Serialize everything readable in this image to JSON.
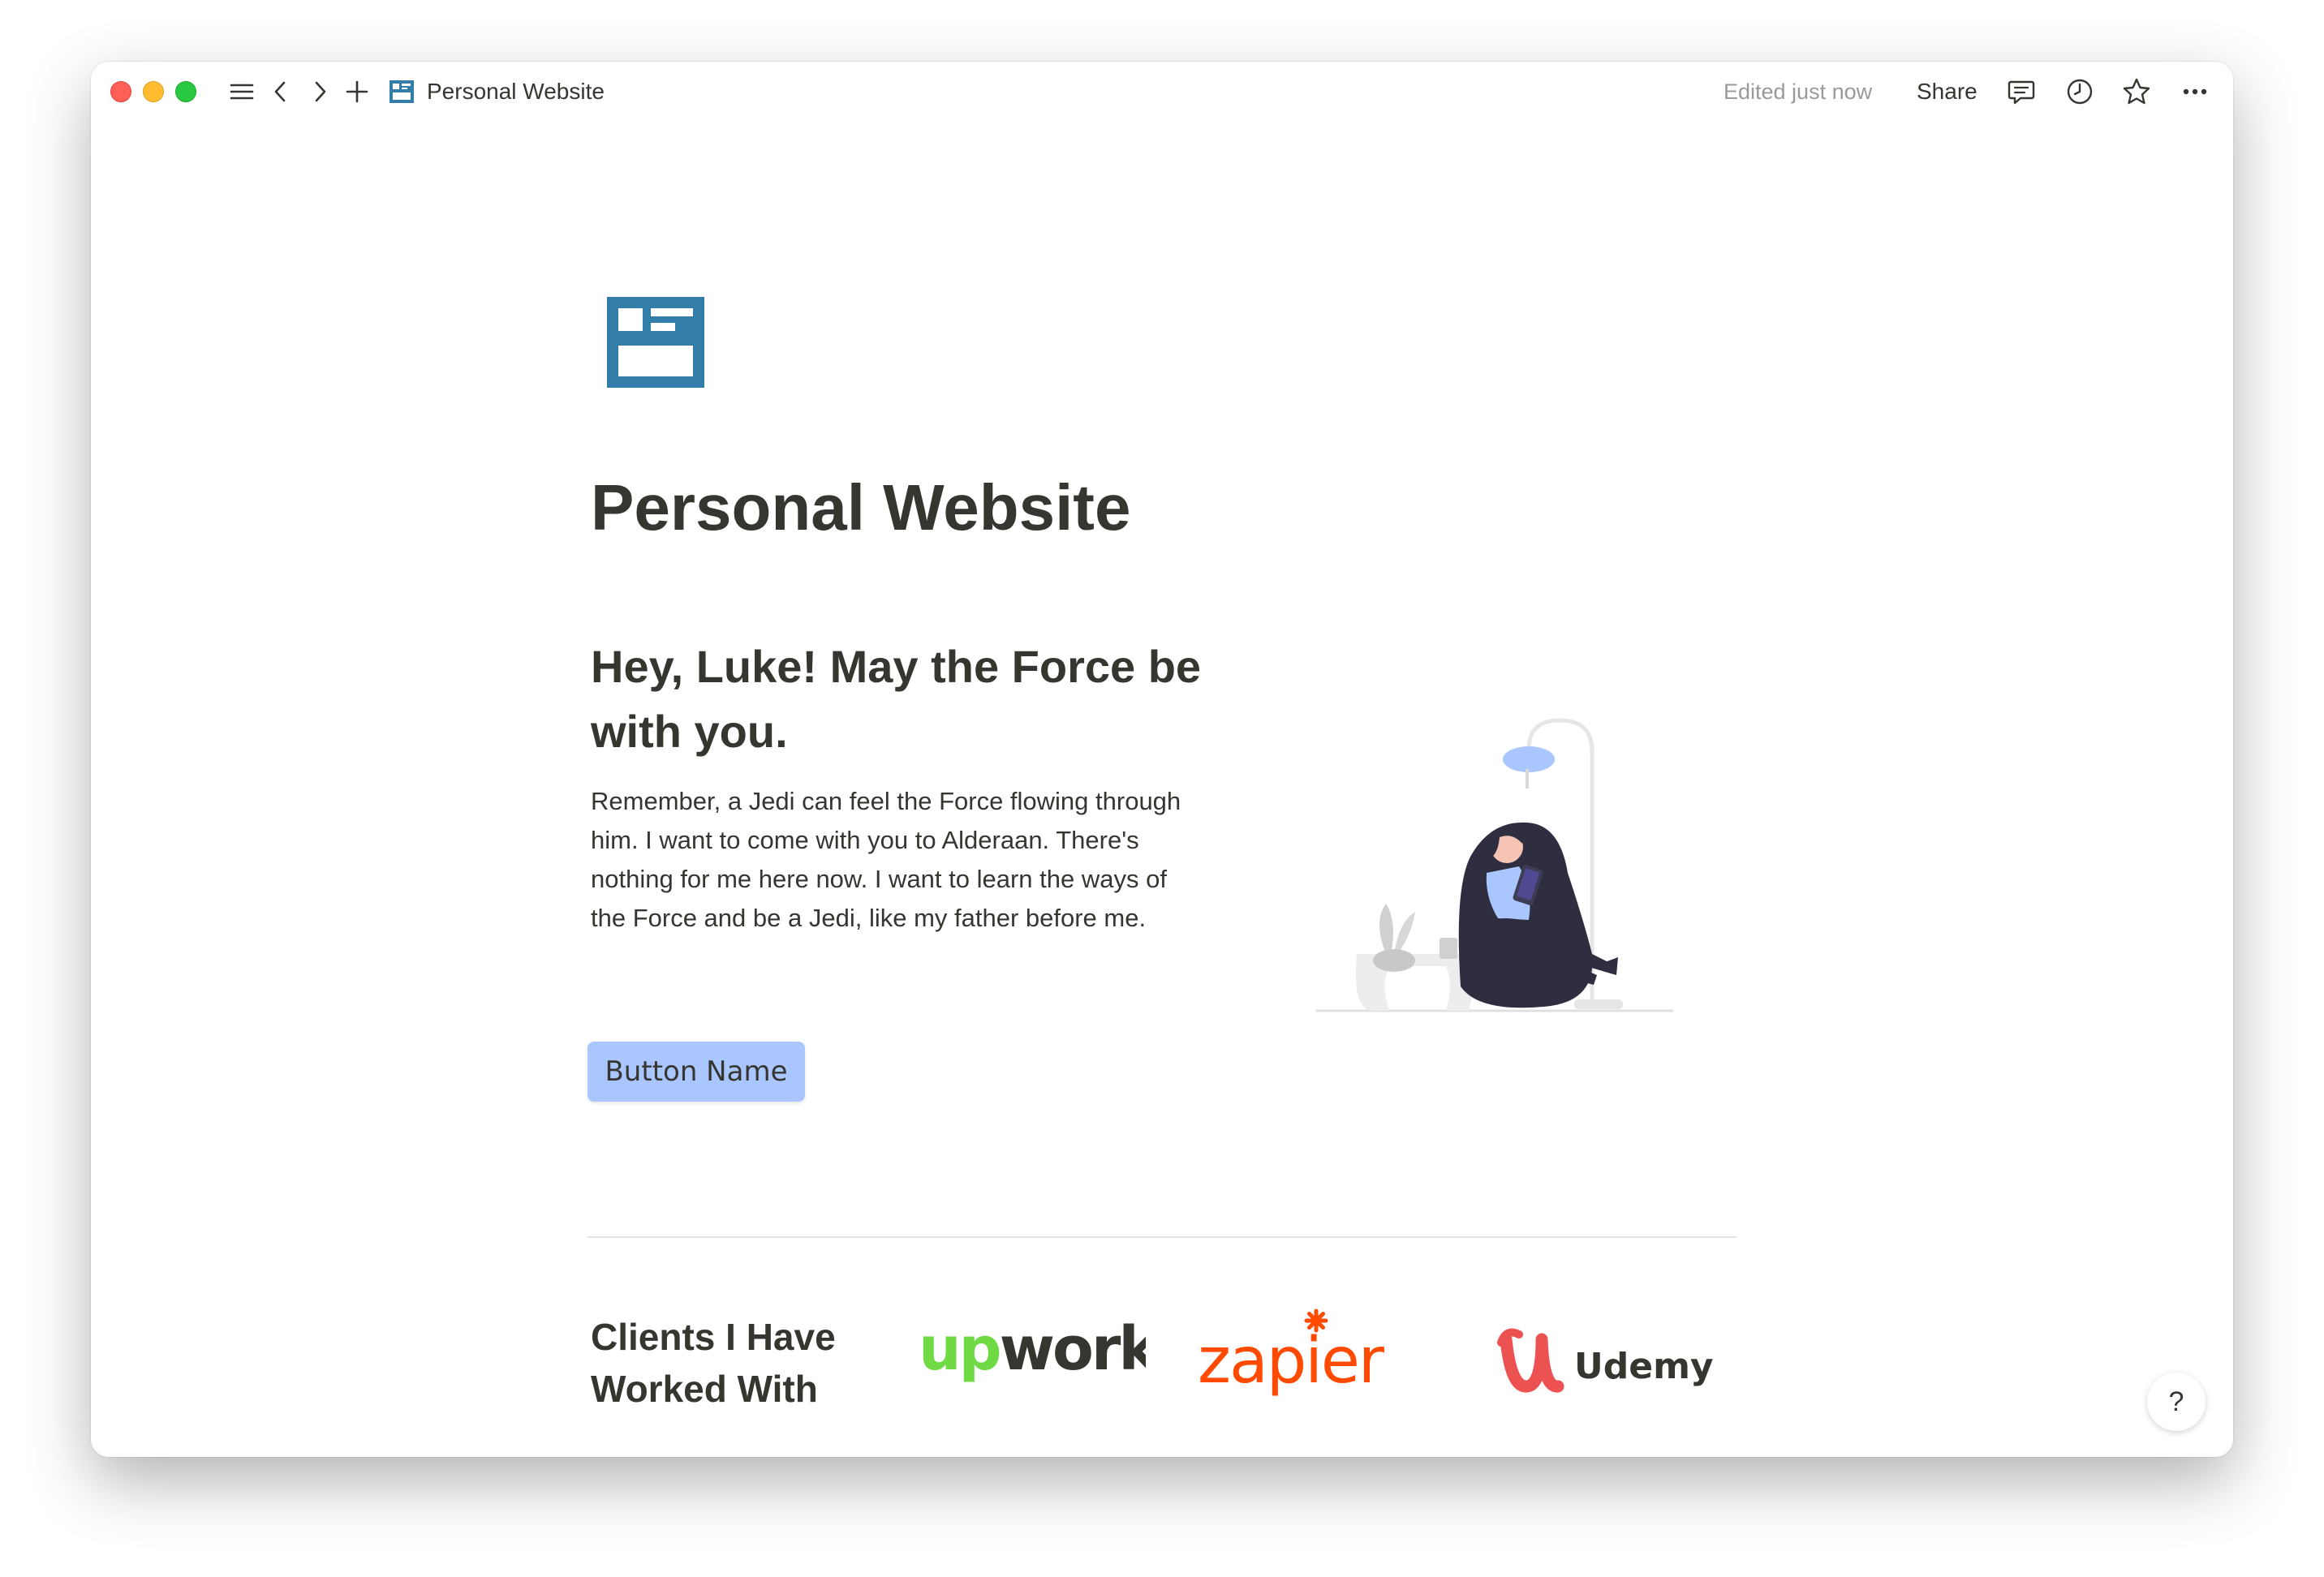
{
  "topbar": {
    "page_title": "Personal Website",
    "edited_status": "Edited just now",
    "share_label": "Share",
    "icons": [
      "menu-icon",
      "back-icon",
      "forward-icon",
      "plus-icon",
      "page-icon",
      "comment-icon",
      "clock-icon",
      "star-icon",
      "more-icon"
    ]
  },
  "page": {
    "title": "Personal Website",
    "icon": "website-layout-icon",
    "hero": {
      "heading": "Hey, Luke! May the Force be with you.",
      "body": "Remember, a Jedi can feel the Force flowing through him. I want to come with you to Alderaan. There's nothing for me here now. I want to learn the ways of the Force and be a Jedi, like my father before me.",
      "button_label": "Button Name",
      "illustration": "person-reading-in-beanbag-illustration"
    },
    "clients": {
      "heading": "Clients I Have Worked With",
      "logos": [
        "upwork",
        "zapier",
        "Udemy"
      ]
    }
  },
  "help": {
    "label": "?"
  },
  "colors": {
    "text": "#37352f",
    "muted": "#9b9a97",
    "button_bg": "#a9c6ff",
    "page_icon": "#337ea9",
    "upwork_green": "#6fda44",
    "zapier_orange": "#ff4a00",
    "udemy_red": "#ec5252"
  }
}
